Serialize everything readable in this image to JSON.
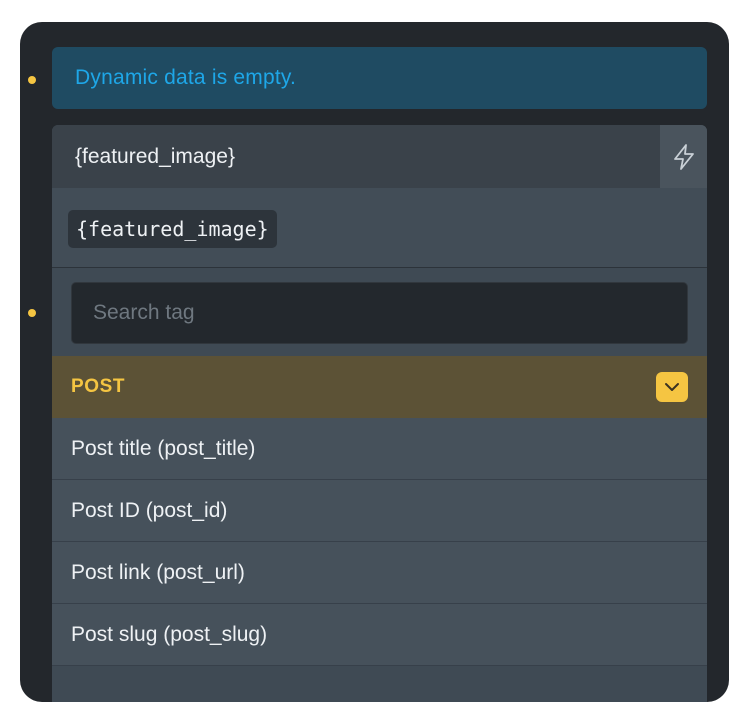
{
  "notice": {
    "text": "Dynamic data is empty."
  },
  "field": {
    "value": "{featured_image}",
    "tag_chip": "{featured_image}"
  },
  "search": {
    "placeholder": "Search tag"
  },
  "group": {
    "label": "POST",
    "items": [
      {
        "label": "Post title (post_title)"
      },
      {
        "label": "Post ID (post_id)"
      },
      {
        "label": "Post link (post_url)"
      },
      {
        "label": "Post slug (post_slug)"
      }
    ]
  },
  "colors": {
    "panel_bg": "#23272c",
    "notice_bg": "#1f4b62",
    "notice_text": "#1ea7e8",
    "accent_yellow": "#f5c542",
    "group_bg": "#5c5236",
    "item_bg": "#46515b"
  },
  "icons": {
    "dynamic_data_button": "lightning-bolt-icon",
    "group_toggle": "chevron-down-icon",
    "indicator": "yellow-dot-indicator"
  }
}
